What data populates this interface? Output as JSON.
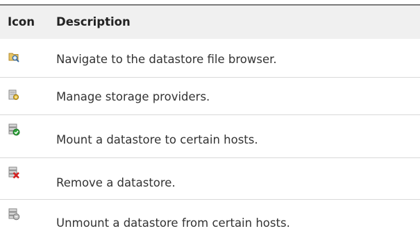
{
  "header": {
    "icon_label": "Icon",
    "description_label": "Description"
  },
  "rows": [
    {
      "icon": "datastore-browse-icon",
      "description": "Navigate to the datastore file browser."
    },
    {
      "icon": "storage-providers-icon",
      "description": "Manage storage providers."
    },
    {
      "icon": "datastore-mount-icon",
      "description": "Mount a datastore to certain hosts."
    },
    {
      "icon": "datastore-remove-icon",
      "description": "Remove a datastore."
    },
    {
      "icon": "datastore-unmount-icon",
      "description": "Unmount a datastore from certain hosts."
    }
  ],
  "colors": {
    "header_bg": "#f0f0f0",
    "rule": "#7a7a7a",
    "divider": "#d9d9d9",
    "text": "#333333",
    "mount_green": "#2ea03a",
    "remove_red": "#d62020"
  }
}
